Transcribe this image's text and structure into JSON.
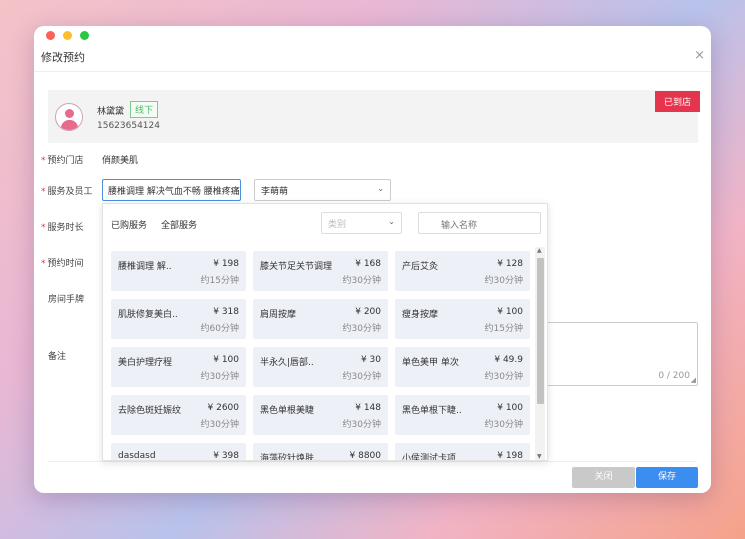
{
  "dialog": {
    "title": "修改预约",
    "close_icon": "×"
  },
  "customer": {
    "name": "林黛黛",
    "tag": "线下",
    "phone": "15623654124",
    "arrived_label": "已到店"
  },
  "form": {
    "required_mark": "*",
    "store_label": "预约门店",
    "store_value": "俏颜美肌",
    "service_staff_label": "服务及员工",
    "service_value": "腰椎调理 解决气血不畅 腰椎疼痛",
    "staff_value": "李萌萌",
    "duration_label": "服务时长",
    "time_label": "预约时间",
    "room_label": "房间手牌",
    "remark_label": "备注",
    "remark_count": "0 / 200"
  },
  "dropdown": {
    "tabs": [
      "已购服务",
      "全部服务"
    ],
    "category_placeholder": "类别",
    "search_placeholder": "输入名称",
    "services": [
      {
        "name": "腰椎调理 解..",
        "price": "¥ 198",
        "duration": "约15分钟"
      },
      {
        "name": "膝关节足关节调理",
        "price": "¥ 168",
        "duration": "约30分钟"
      },
      {
        "name": "产后艾灸",
        "price": "¥ 128",
        "duration": "约30分钟"
      },
      {
        "name": "肌肤修复美白..",
        "price": "¥ 318",
        "duration": "约60分钟"
      },
      {
        "name": "肩周按摩",
        "price": "¥ 200",
        "duration": "约30分钟"
      },
      {
        "name": "瘦身按摩",
        "price": "¥ 100",
        "duration": "约15分钟"
      },
      {
        "name": "美白护理疗程",
        "price": "¥ 100",
        "duration": "约30分钟"
      },
      {
        "name": "半永久|唇部..",
        "price": "¥ 30",
        "duration": "约30分钟"
      },
      {
        "name": "单色美甲 单次",
        "price": "¥ 49.9",
        "duration": "约30分钟"
      },
      {
        "name": "去除色斑妊娠纹",
        "price": "¥ 2600",
        "duration": "约30分钟"
      },
      {
        "name": "黑色单根美睫",
        "price": "¥ 148",
        "duration": "约30分钟"
      },
      {
        "name": "黑色单根下睫..",
        "price": "¥ 100",
        "duration": "约30分钟"
      },
      {
        "name": "dasdasd",
        "price": "¥ 398",
        "duration": ""
      },
      {
        "name": "海藻矽针焕肤..",
        "price": "¥ 8800",
        "duration": ""
      },
      {
        "name": "小侯测试卡项",
        "price": "¥ 198",
        "duration": ""
      }
    ]
  },
  "footer": {
    "close_label": "关闭",
    "save_label": "保存"
  },
  "colors": {
    "primary": "#3b8ef0",
    "danger": "#e5344d",
    "success": "#52b86a"
  }
}
